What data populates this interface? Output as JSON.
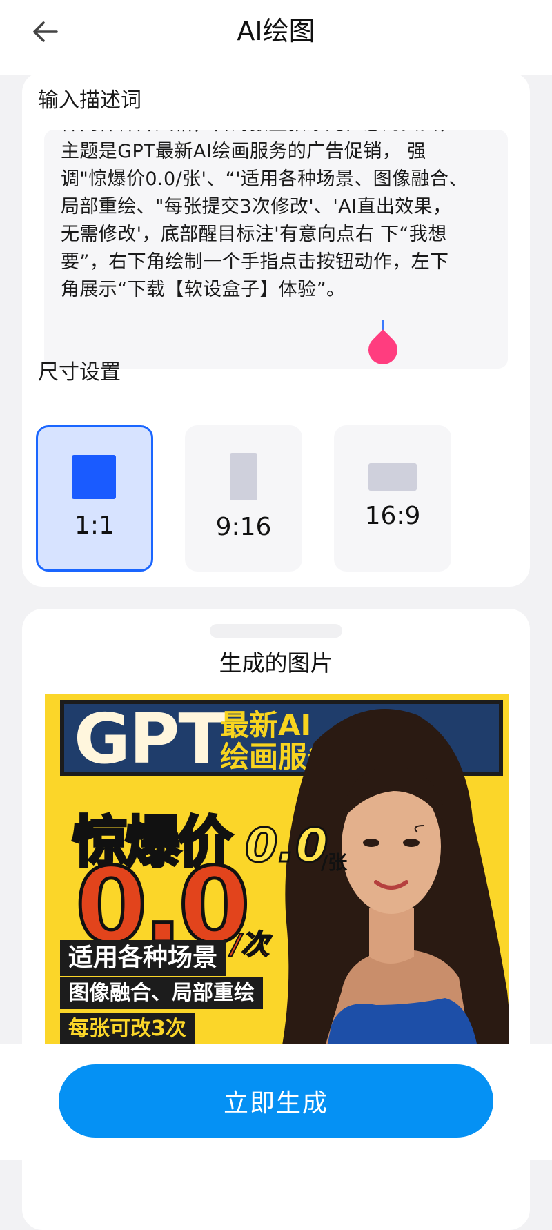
{
  "header": {
    "title": "AI绘图"
  },
  "prompt": {
    "section_label": "输入描述词",
    "lines": [
      "幛门样幛开风格，台海报整张原光性感的女女，",
      "主题是GPT最新AI绘画服务的广告促销， 强",
      "调\"惊爆价0.0/张'、“'适用各种场景、图像融合、",
      "局部重绘、\"每张提交3次修改'、'AI直出效果，",
      "无需修改'，底部醒目标注'有意向点右 下“我想",
      "要”，右下角绘制一个手指点击按钮动作，左下",
      "角展示“下载【软设盒子】体验”。"
    ],
    "cursor_color": "#3a7afe",
    "handle_color": "#ff3d7f"
  },
  "size": {
    "section_label": "尺寸设置",
    "options": [
      {
        "label": "1:1",
        "selected": true
      },
      {
        "label": "9:16",
        "selected": false
      },
      {
        "label": "16:9",
        "selected": false
      }
    ]
  },
  "result": {
    "title": "生成的图片",
    "poster": {
      "gpt": "GPT",
      "headline_line1": "最新AI",
      "headline_line2": "绘画服务",
      "jingbao": "惊爆价",
      "small_price": "0.0",
      "small_unit": "/张",
      "big_price": "0.0",
      "big_unit": "/次",
      "tag1": "适用各种场景",
      "tag2": "图像融合、局部重绘",
      "tag3": "每张可改3次"
    }
  },
  "actions": {
    "generate_label": "立即生成"
  },
  "colors": {
    "accent": "#0591f4",
    "selected_border": "#1a66ff",
    "selected_bg": "#d7e3ff",
    "poster_yellow": "#fbd629",
    "poster_red": "#e2441c"
  },
  "icons": {
    "back": "arrow-left-icon"
  }
}
